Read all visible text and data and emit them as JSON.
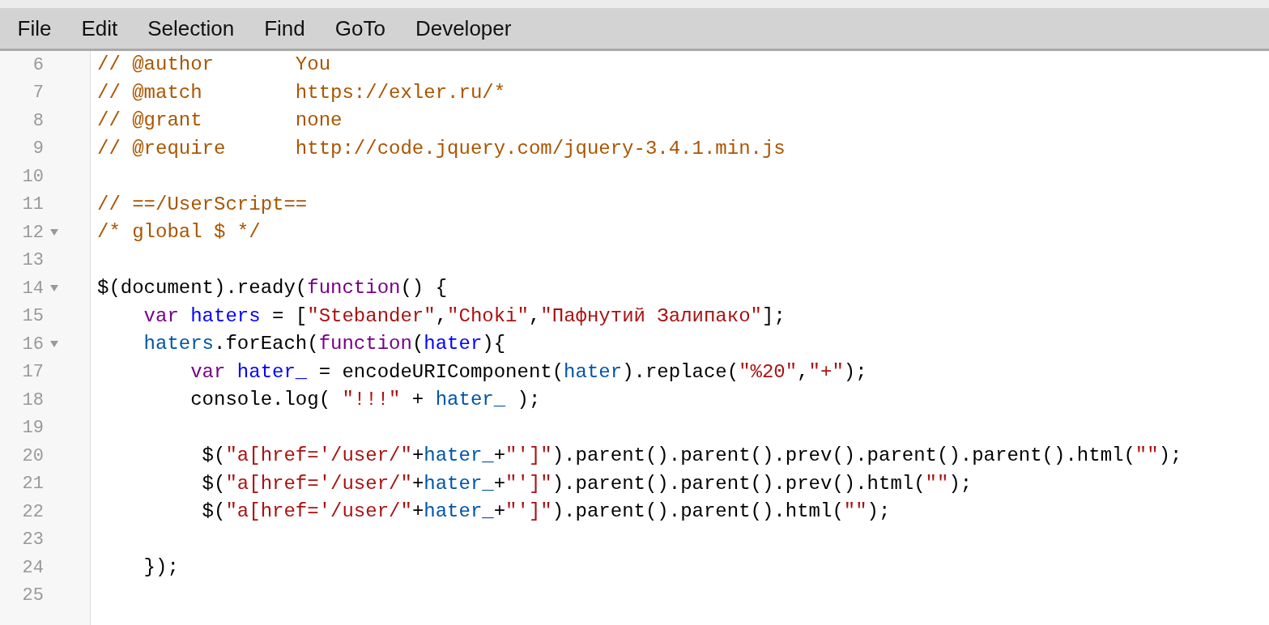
{
  "menu": [
    {
      "label": "File"
    },
    {
      "label": "Edit"
    },
    {
      "label": "Selection"
    },
    {
      "label": "Find"
    },
    {
      "label": "GoTo"
    },
    {
      "label": "Developer"
    }
  ],
  "editor": {
    "lines": [
      {
        "number": "6",
        "foldable": false,
        "tokens": [
          {
            "kind": "comment",
            "text": "// @author       You"
          }
        ]
      },
      {
        "number": "7",
        "foldable": false,
        "tokens": [
          {
            "kind": "comment",
            "text": "// @match        https://exler.ru/*"
          }
        ]
      },
      {
        "number": "8",
        "foldable": false,
        "tokens": [
          {
            "kind": "comment",
            "text": "// @grant        none"
          }
        ]
      },
      {
        "number": "9",
        "foldable": false,
        "tokens": [
          {
            "kind": "comment",
            "text": "// @require      http://code.jquery.com/jquery-3.4.1.min.js"
          }
        ]
      },
      {
        "number": "10",
        "foldable": false
      },
      {
        "number": "11",
        "foldable": false,
        "tokens": [
          {
            "kind": "comment",
            "text": "// ==/UserScript=="
          }
        ]
      },
      {
        "number": "12",
        "foldable": true,
        "tokens": [
          {
            "kind": "comment",
            "text": "/* global $ */"
          }
        ]
      },
      {
        "number": "13",
        "foldable": false
      },
      {
        "number": "14",
        "foldable": true,
        "tokens": [
          {
            "kind": "plain",
            "text": "$(document).ready("
          },
          {
            "kind": "keyword",
            "text": "function"
          },
          {
            "kind": "plain",
            "text": "() {"
          }
        ]
      },
      {
        "number": "15",
        "foldable": false,
        "tokens": [
          {
            "kind": "keyword",
            "text": "    var "
          },
          {
            "kind": "def",
            "text": "haters"
          },
          {
            "kind": "plain",
            "text": " = ["
          },
          {
            "kind": "string",
            "text": "\"Stebander\""
          },
          {
            "kind": "plain",
            "text": ","
          },
          {
            "kind": "string",
            "text": "\"Choki\""
          },
          {
            "kind": "plain",
            "text": ","
          },
          {
            "kind": "string",
            "text": "\"Пафнутий Залипако\""
          },
          {
            "kind": "plain",
            "text": "];"
          }
        ]
      },
      {
        "number": "16",
        "foldable": true,
        "tokens": [
          {
            "kind": "variable",
            "text": "    haters"
          },
          {
            "kind": "plain",
            "text": ".forEach("
          },
          {
            "kind": "keyword",
            "text": "function"
          },
          {
            "kind": "plain",
            "text": "("
          },
          {
            "kind": "def",
            "text": "hater"
          },
          {
            "kind": "plain",
            "text": "){"
          }
        ]
      },
      {
        "number": "17",
        "foldable": false,
        "tokens": [
          {
            "kind": "keyword",
            "text": "        var "
          },
          {
            "kind": "def",
            "text": "hater_"
          },
          {
            "kind": "plain",
            "text": " = encodeURIComponent("
          },
          {
            "kind": "variable",
            "text": "hater"
          },
          {
            "kind": "plain",
            "text": ").replace("
          },
          {
            "kind": "string",
            "text": "\"%20\""
          },
          {
            "kind": "plain",
            "text": ","
          },
          {
            "kind": "string",
            "text": "\"+\""
          },
          {
            "kind": "plain",
            "text": ");"
          }
        ]
      },
      {
        "number": "18",
        "foldable": false,
        "tokens": [
          {
            "kind": "plain",
            "text": "        console.log( "
          },
          {
            "kind": "string",
            "text": "\"!!!\""
          },
          {
            "kind": "plain",
            "text": " + "
          },
          {
            "kind": "variable",
            "text": "hater_"
          },
          {
            "kind": "plain",
            "text": " );"
          }
        ]
      },
      {
        "number": "19",
        "foldable": false
      },
      {
        "number": "20",
        "foldable": false,
        "tokens": [
          {
            "kind": "plain",
            "text": "         $("
          },
          {
            "kind": "string",
            "text": "\"a[href='/user/\""
          },
          {
            "kind": "plain",
            "text": "+"
          },
          {
            "kind": "variable",
            "text": "hater_"
          },
          {
            "kind": "plain",
            "text": "+"
          },
          {
            "kind": "string",
            "text": "\"']\""
          },
          {
            "kind": "plain",
            "text": ").parent().parent().prev().parent().parent().html("
          },
          {
            "kind": "string",
            "text": "\"\""
          },
          {
            "kind": "plain",
            "text": ");"
          }
        ]
      },
      {
        "number": "21",
        "foldable": false,
        "tokens": [
          {
            "kind": "plain",
            "text": "         $("
          },
          {
            "kind": "string",
            "text": "\"a[href='/user/\""
          },
          {
            "kind": "plain",
            "text": "+"
          },
          {
            "kind": "variable",
            "text": "hater_"
          },
          {
            "kind": "plain",
            "text": "+"
          },
          {
            "kind": "string",
            "text": "\"']\""
          },
          {
            "kind": "plain",
            "text": ").parent().parent().prev().html("
          },
          {
            "kind": "string",
            "text": "\"\""
          },
          {
            "kind": "plain",
            "text": ");"
          }
        ]
      },
      {
        "number": "22",
        "foldable": false,
        "tokens": [
          {
            "kind": "plain",
            "text": "         $("
          },
          {
            "kind": "string",
            "text": "\"a[href='/user/\""
          },
          {
            "kind": "plain",
            "text": "+"
          },
          {
            "kind": "variable",
            "text": "hater_"
          },
          {
            "kind": "plain",
            "text": "+"
          },
          {
            "kind": "string",
            "text": "\"']\""
          },
          {
            "kind": "plain",
            "text": ").parent().parent().html("
          },
          {
            "kind": "string",
            "text": "\"\""
          },
          {
            "kind": "plain",
            "text": ");"
          }
        ]
      },
      {
        "number": "23",
        "foldable": false
      },
      {
        "number": "24",
        "foldable": false,
        "tokens": [
          {
            "kind": "plain",
            "text": "    });"
          }
        ]
      },
      {
        "number": "25",
        "foldable": false
      }
    ]
  }
}
